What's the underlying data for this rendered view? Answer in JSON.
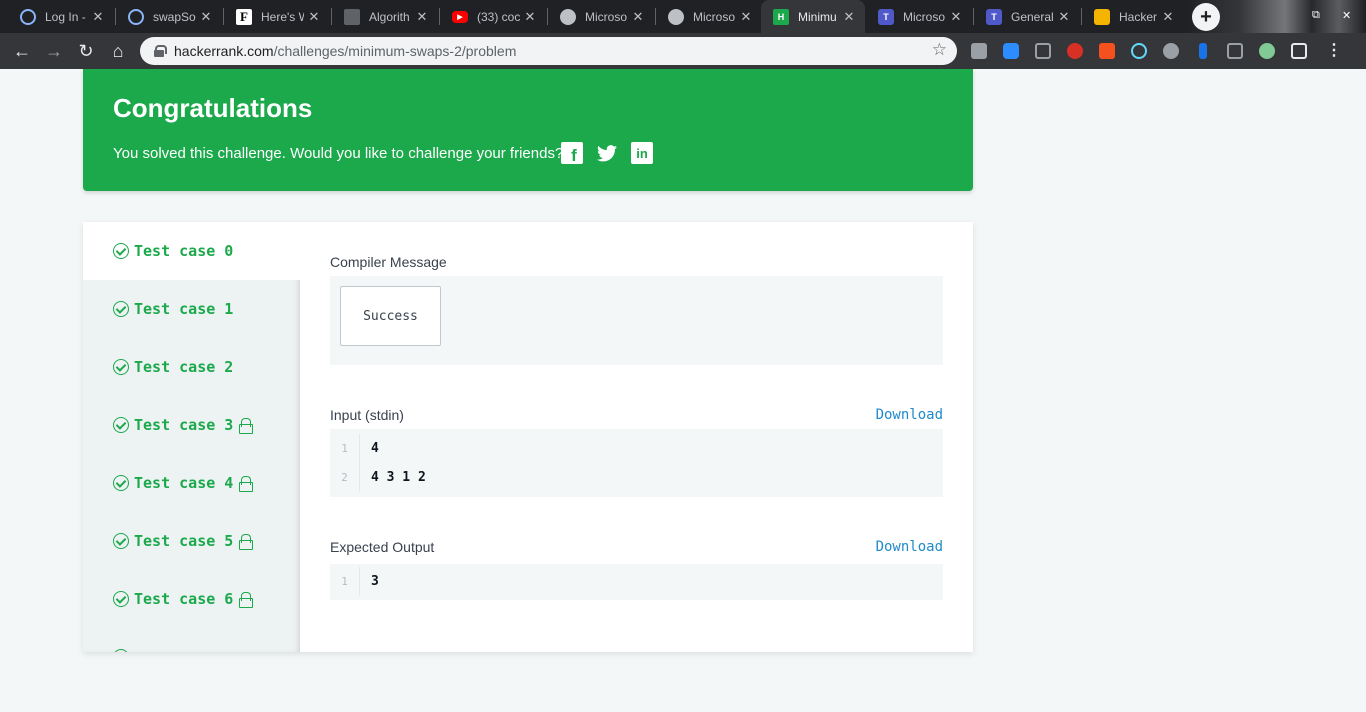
{
  "browser": {
    "tabs": [
      {
        "title": "Log In -",
        "icon": "globe-icon"
      },
      {
        "title": "swapSo",
        "icon": "globe-icon"
      },
      {
        "title": "Here's W",
        "icon": "f-logo-icon"
      },
      {
        "title": "Algorith",
        "icon": "terminal-icon"
      },
      {
        "title": "(33) coc",
        "icon": "youtube-icon"
      },
      {
        "title": "Microso",
        "icon": "globe-icon"
      },
      {
        "title": "Microso",
        "icon": "globe-icon"
      },
      {
        "title": "Minimu",
        "icon": "hackerrank-icon"
      },
      {
        "title": "Microso",
        "icon": "teams-icon"
      },
      {
        "title": "General",
        "icon": "teams-icon"
      },
      {
        "title": "Hacker",
        "icon": "hackerrank-badge-icon"
      }
    ],
    "url_domain": "hackerrank.com",
    "url_path": "/challenges/minimum-swaps-2/problem",
    "colors": {
      "chrome_dark": "#202124",
      "chrome_toolbar": "#35363a"
    }
  },
  "congrats": {
    "title": "Congratulations",
    "message": "You solved this challenge. Would you like to challenge your friends?",
    "social_icons": [
      "facebook-icon",
      "twitter-icon",
      "linkedin-icon"
    ],
    "color": "#1ba94c"
  },
  "test_cases": [
    {
      "label": "Test case 0",
      "locked": false,
      "active": true
    },
    {
      "label": "Test case 1",
      "locked": false,
      "active": false
    },
    {
      "label": "Test case 2",
      "locked": false,
      "active": false
    },
    {
      "label": "Test case 3",
      "locked": true,
      "active": false
    },
    {
      "label": "Test case 4",
      "locked": true,
      "active": false
    },
    {
      "label": "Test case 5",
      "locked": true,
      "active": false
    },
    {
      "label": "Test case 6",
      "locked": true,
      "active": false
    }
  ],
  "compiler": {
    "label": "Compiler Message",
    "message": "Success"
  },
  "input": {
    "label": "Input (stdin)",
    "download": "Download",
    "lines": [
      {
        "n": "1",
        "text": "4"
      },
      {
        "n": "2",
        "text": "4 3 1 2"
      }
    ]
  },
  "expected": {
    "label": "Expected Output",
    "download": "Download",
    "lines": [
      {
        "n": "1",
        "text": "3"
      }
    ]
  }
}
